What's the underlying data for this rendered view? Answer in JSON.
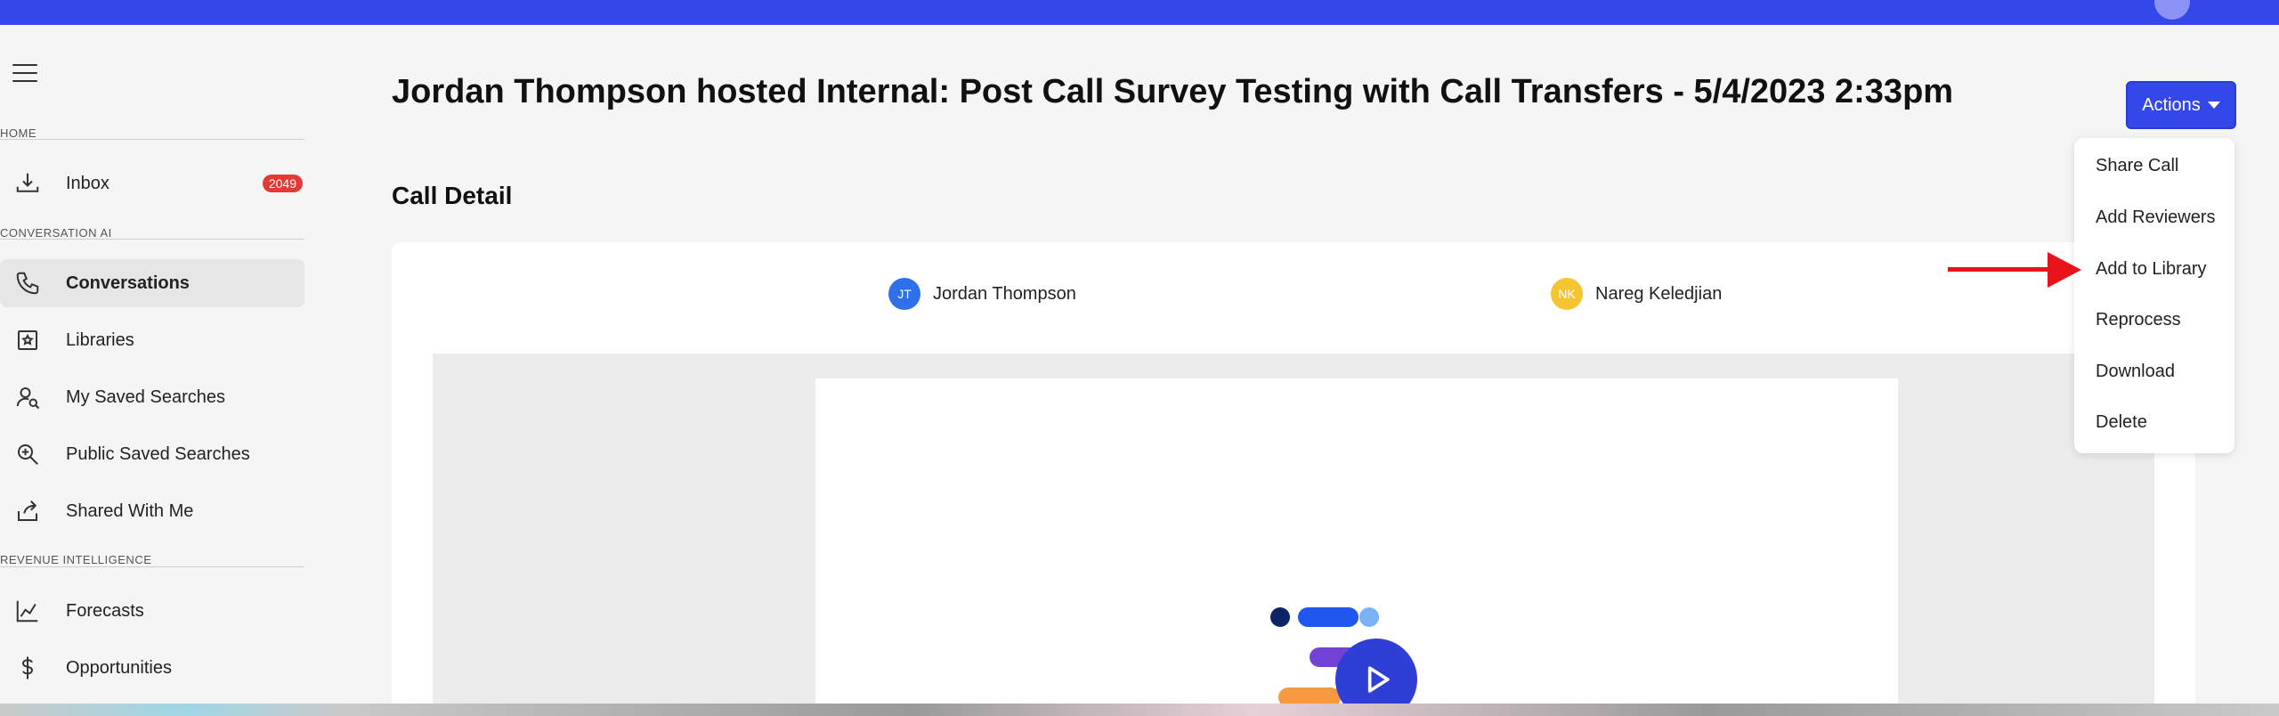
{
  "header": {
    "avatar": "user-avatar"
  },
  "sidebar": {
    "menu_icon": "hamburger-icon",
    "sections": {
      "home": "HOME",
      "conversation_ai": "CONVERSATION AI",
      "revenue_intelligence": "REVENUE INTELLIGENCE"
    },
    "items": [
      {
        "label": "Inbox",
        "icon": "inbox-icon",
        "badge": "2049"
      },
      {
        "label": "Conversations",
        "icon": "phone-icon",
        "active": true
      },
      {
        "label": "Libraries",
        "icon": "library-icon"
      },
      {
        "label": "My Saved Searches",
        "icon": "person-search-icon"
      },
      {
        "label": "Public Saved Searches",
        "icon": "zoom-in-icon"
      },
      {
        "label": "Shared With Me",
        "icon": "share-icon"
      },
      {
        "label": "Forecasts",
        "icon": "chart-line-icon"
      },
      {
        "label": "Opportunities",
        "icon": "dollar-icon"
      }
    ]
  },
  "main": {
    "title": "Jordan Thompson hosted Internal: Post Call Survey Testing with Call Transfers - 5/4/2023 2:33pm",
    "actions_label": "Actions",
    "section_title": "Call Detail",
    "participants": [
      {
        "initials": "JT",
        "name": "Jordan Thompson",
        "color": "#2f6fe8"
      },
      {
        "initials": "NK",
        "name": "Nareg Keledjian",
        "color": "#f5c531"
      }
    ]
  },
  "actions_menu": {
    "items": [
      "Share Call",
      "Add Reviewers",
      "Add to Library",
      "Reprocess",
      "Download",
      "Delete"
    ]
  },
  "colors": {
    "brand": "#3448ea",
    "badge": "#e53935",
    "annotation_arrow": "#e8141b"
  }
}
